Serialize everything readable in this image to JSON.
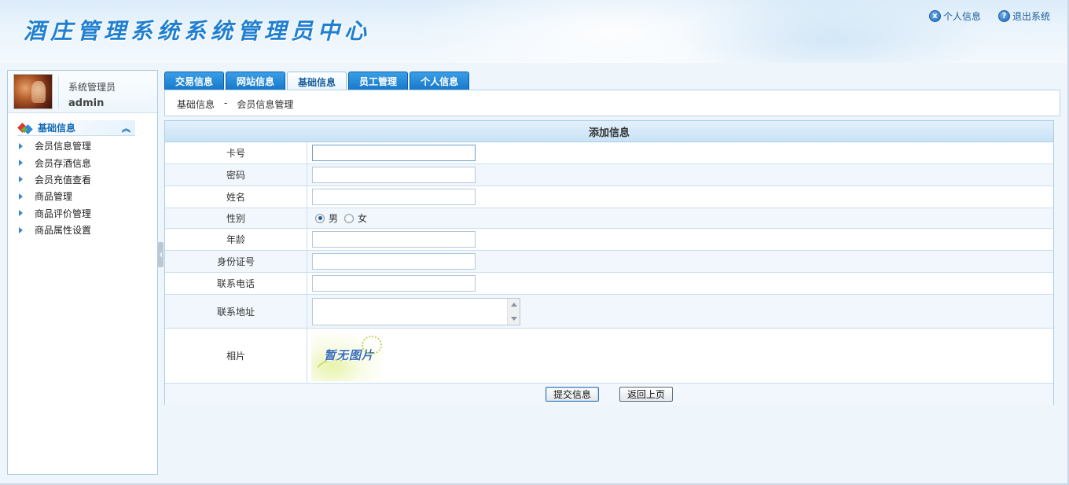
{
  "app": {
    "title": "酒庄管理系统系统管理员中心"
  },
  "top_links": [
    {
      "label": "个人信息",
      "icon": "x-circle-icon"
    },
    {
      "label": "退出系统",
      "icon": "question-circle-icon"
    }
  ],
  "user": {
    "role": "系统管理员",
    "name": "admin"
  },
  "sidebar": {
    "section_title": "基础信息",
    "items": [
      {
        "label": "会员信息管理"
      },
      {
        "label": "会员存酒信息"
      },
      {
        "label": "会员充值查看"
      },
      {
        "label": "商品管理"
      },
      {
        "label": "商品评价管理"
      },
      {
        "label": "商品属性设置"
      }
    ]
  },
  "tabs": [
    {
      "label": "交易信息",
      "active": false
    },
    {
      "label": "网站信息",
      "active": false
    },
    {
      "label": "基础信息",
      "active": true
    },
    {
      "label": "员工管理",
      "active": false
    },
    {
      "label": "个人信息",
      "active": false
    }
  ],
  "breadcrumb": {
    "section": "基础信息",
    "separator": "-",
    "page": "会员信息管理"
  },
  "form": {
    "title": "添加信息",
    "fields": {
      "card_no": {
        "label": "卡号",
        "value": ""
      },
      "password": {
        "label": "密码",
        "value": ""
      },
      "name": {
        "label": "姓名",
        "value": ""
      },
      "gender": {
        "label": "性别",
        "options": [
          "男",
          "女"
        ],
        "selected": "男"
      },
      "age": {
        "label": "年龄",
        "value": ""
      },
      "id_number": {
        "label": "身份证号",
        "value": ""
      },
      "phone": {
        "label": "联系电话",
        "value": ""
      },
      "address": {
        "label": "联系地址",
        "value": ""
      },
      "photo": {
        "label": "相片",
        "placeholder_text": "暂无图片"
      }
    },
    "submit_label": "提交信息",
    "back_label": "返回上页"
  },
  "colors": {
    "accent": "#1677c9",
    "title": "#1f7fd0",
    "border": "#a7cde8"
  }
}
